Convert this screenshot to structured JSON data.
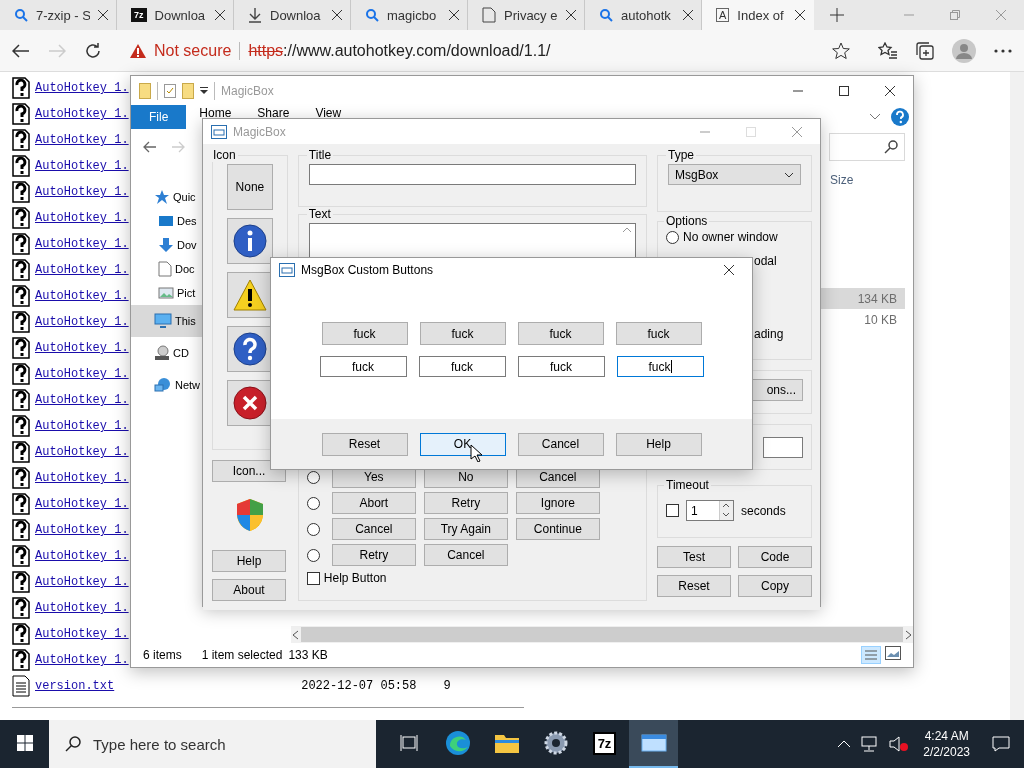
{
  "browser": {
    "tabs": [
      {
        "label": "7-zxip - S",
        "kind": "search",
        "selected": false
      },
      {
        "label": "Downloa",
        "kind": "sevenzip",
        "badge": "7z",
        "selected": false
      },
      {
        "label": "Downloa",
        "kind": "download",
        "selected": false
      },
      {
        "label": "magicbo",
        "kind": "search",
        "selected": false
      },
      {
        "label": "Privacy e",
        "kind": "document",
        "selected": false
      },
      {
        "label": "autohotk",
        "kind": "search",
        "selected": false
      },
      {
        "label": "Index of",
        "kind": "letter",
        "badge": "A",
        "selected": true
      }
    ],
    "address": {
      "security": "Not secure",
      "scheme": "https",
      "rest": "://www.autohotkey.com/download/1.1/"
    }
  },
  "page": {
    "links": [
      "AutoHotkey_1.",
      "AutoHotkey_1.",
      "AutoHotkey_1.",
      "AutoHotkey_1.",
      "AutoHotkey_1.",
      "AutoHotkey_1.",
      "AutoHotkey_1.",
      "AutoHotkey_1.",
      "AutoHotkey_1.",
      "AutoHotkey_1.",
      "AutoHotkey_1.",
      "AutoHotkey_1.",
      "AutoHotkey_1.",
      "AutoHotkey_1.",
      "AutoHotkey_1.",
      "AutoHotkey_1.",
      "AutoHotkey_1.",
      "AutoHotkey_1.",
      "AutoHotkey_1.",
      "AutoHotkey_1.",
      "AutoHotkey_1.",
      "AutoHotkey_1.",
      "AutoHotkey_1."
    ],
    "file": {
      "name": "version.txt",
      "date": "2022-12-07 05:58",
      "size": "9"
    }
  },
  "explorer": {
    "title": "MagicBox",
    "ribbon_tabs": [
      {
        "label": "File",
        "selected": true
      },
      {
        "label": "Home",
        "selected": false
      },
      {
        "label": "Share",
        "selected": false
      },
      {
        "label": "View",
        "selected": false
      }
    ],
    "nav_items": [
      {
        "label": "Quic",
        "kind": "star",
        "selected": false
      },
      {
        "label": "Des",
        "kind": "desktop",
        "selected": false
      },
      {
        "label": "Dov",
        "kind": "download",
        "selected": false
      },
      {
        "label": "Doc",
        "kind": "document",
        "selected": false
      },
      {
        "label": "Pict",
        "kind": "picture",
        "selected": false
      },
      {
        "label": "This",
        "kind": "pc",
        "selected": true
      },
      {
        "label": "CD",
        "kind": "cd",
        "selected": false
      },
      {
        "label": "Netw",
        "kind": "network",
        "selected": false
      }
    ],
    "column": "Size",
    "rows": [
      {
        "size": "134 KB",
        "selected": true
      },
      {
        "size": "10 KB",
        "selected": false
      }
    ],
    "status": {
      "count": "6 items",
      "selection": "1 item selected",
      "size": "133 KB"
    }
  },
  "magicbox": {
    "title": "MagicBox",
    "icon_group": {
      "label": "Icon",
      "choices": [
        {
          "kind": "none",
          "label": "None"
        },
        {
          "kind": "info"
        },
        {
          "kind": "warning"
        },
        {
          "kind": "question"
        },
        {
          "kind": "error"
        }
      ],
      "browse": "Icon...",
      "help": "Help",
      "about": "About"
    },
    "title_group": {
      "label": "Title"
    },
    "text_group": {
      "label": "Text"
    },
    "type_group": {
      "label": "Type",
      "value": "MsgBox"
    },
    "options": {
      "label": "Options",
      "first": {
        "label": "No owner window",
        "selected": false
      },
      "fragments": [
        "odal",
        "ading"
      ]
    },
    "more_button": "ons...",
    "timeout": {
      "label": "Timeout",
      "checked": false,
      "value": "1",
      "unit": "seconds"
    },
    "actions": [
      "Test",
      "Code",
      "Reset",
      "Copy"
    ],
    "button_sets": [
      {
        "selected": false,
        "buttons": [
          "Yes",
          "No",
          "Cancel"
        ]
      },
      {
        "selected": false,
        "buttons": [
          "Abort",
          "Retry",
          "Ignore"
        ]
      },
      {
        "selected": false,
        "buttons": [
          "Cancel",
          "Try Again",
          "Continue"
        ]
      },
      {
        "selected": false,
        "buttons": [
          "Retry",
          "Cancel"
        ]
      }
    ],
    "help_button": {
      "label": "Help Button",
      "checked": false
    }
  },
  "dialog": {
    "title": "MsgBox Custom Buttons",
    "preview": [
      "fuck",
      "fuck",
      "fuck",
      "fuck"
    ],
    "fields": [
      {
        "value": "fuck",
        "focused": false
      },
      {
        "value": "fuck",
        "focused": false
      },
      {
        "value": "fuck",
        "focused": false
      },
      {
        "value": "fuck",
        "focused": true
      }
    ],
    "footer": [
      {
        "label": "Reset",
        "focused": false
      },
      {
        "label": "OK",
        "focused": true
      },
      {
        "label": "Cancel",
        "focused": false
      },
      {
        "label": "Help",
        "focused": false
      }
    ]
  },
  "taskbar": {
    "search": {
      "placeholder": "Type here to search"
    },
    "apps": [
      {
        "kind": "taskview",
        "active": false
      },
      {
        "kind": "edge",
        "active": false
      },
      {
        "kind": "folder",
        "active": false
      },
      {
        "kind": "gear",
        "active": false
      },
      {
        "kind": "sevenzip",
        "label": "7z",
        "active": false
      },
      {
        "kind": "window",
        "active": true
      }
    ],
    "time": "4:24 AM",
    "date": "2/2/2023"
  }
}
